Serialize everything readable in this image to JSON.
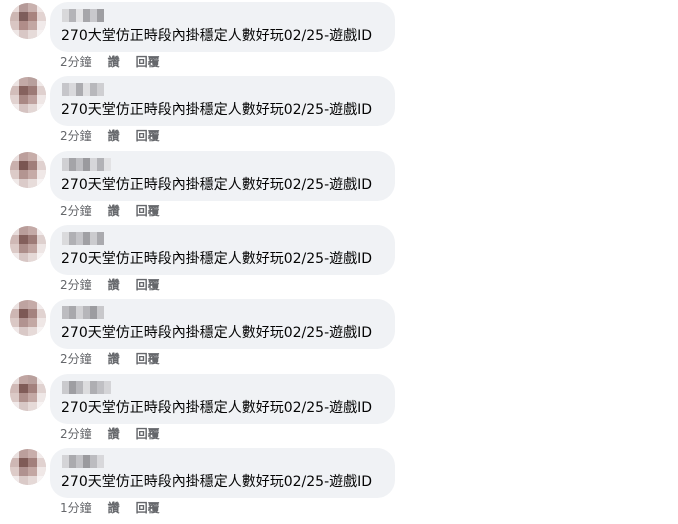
{
  "comments": [
    {
      "text": "270大堂仿正時段內掛穩定人數好玩02/25-遊戲ID",
      "time": "2分鐘",
      "like": "讚",
      "reply": "回覆"
    },
    {
      "text": "270天堂仿正時段內掛穩定人數好玩02/25-遊戲ID",
      "time": "2分鐘",
      "like": "讚",
      "reply": "回覆"
    },
    {
      "text": "270天堂仿正時段內掛穩定人數好玩02/25-遊戲ID",
      "time": "2分鐘",
      "like": "讚",
      "reply": "回覆"
    },
    {
      "text": "270天堂仿正時段內掛穩定人數好玩02/25-遊戲ID",
      "time": "2分鐘",
      "like": "讚",
      "reply": "回覆"
    },
    {
      "text": "270天堂仿正時段內掛穩定人數好玩02/25-遊戲ID",
      "time": "2分鐘",
      "like": "讚",
      "reply": "回覆"
    },
    {
      "text": "270天堂仿正時段內掛穩定人數好玩02/25-遊戲ID",
      "time": "2分鐘",
      "like": "讚",
      "reply": "回覆"
    },
    {
      "text": "270天堂仿正時段內掛穩定人數好玩02/25-遊戲ID",
      "time": "1分鐘",
      "like": "讚",
      "reply": "回覆"
    }
  ]
}
